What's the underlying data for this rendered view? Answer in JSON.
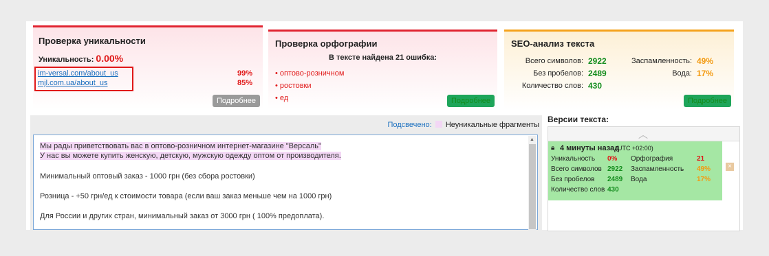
{
  "uniqueness": {
    "title": "Проверка уникальности",
    "label": "Уникальность:",
    "value": "0.00%",
    "sources": [
      {
        "url": "im-versal.com/about_us",
        "pct": "99%"
      },
      {
        "url": "mjl.com.ua/about_us",
        "pct": "85%"
      }
    ],
    "button": "Подробнее"
  },
  "spelling": {
    "title": "Проверка орфографии",
    "summary": "В тексте найдена 21 ошибка:",
    "errors": [
      "оптово-розничном",
      "ростовки",
      "ед"
    ],
    "button": "Подробнее"
  },
  "seo": {
    "title": "SEO-анализ текста",
    "total_chars_label": "Всего символов:",
    "total_chars": "2922",
    "no_spaces_label": "Без пробелов:",
    "no_spaces": "2489",
    "words_label": "Количество слов:",
    "words": "430",
    "spam_label": "Заспамленность:",
    "spam": "49%",
    "water_label": "Вода:",
    "water": "17%",
    "button": "Подробнее"
  },
  "editor": {
    "highlighted_label": "Подсвечено:",
    "legend": "Неуникальные фрагменты",
    "lines": [
      "Мы рады приветствовать вас в оптово-розничном интернет-магазине \"Версаль\"",
      "У нас вы можете купить женскую, детскую, мужскую одежду оптом от производителя.",
      "Минимальный оптовый заказ - 1000 грн (без сбора ростовки)",
      "Розница - +50 грн/ед к стоимости товара (если ваш заказ меньше чем на 1000 грн)",
      "Для России и других стран, минимальный заказ от 3000 грн ( 100% предоплата)."
    ]
  },
  "versions": {
    "title": "Версии текста:",
    "item": {
      "time": "4 минуты назад",
      "tz": "(UTC +02:00)",
      "uniq_label": "Уникальность",
      "uniq": "0%",
      "spelling_label": "Орфография",
      "spelling": "21",
      "chars_label": "Всего символов",
      "chars": "2922",
      "spam_label": "Заспамленность",
      "spam": "49%",
      "no_spaces_label": "Без пробелов",
      "no_spaces": "2489",
      "water_label": "Вода",
      "water": "17%",
      "words_label": "Количество слов",
      "words": "430"
    }
  }
}
